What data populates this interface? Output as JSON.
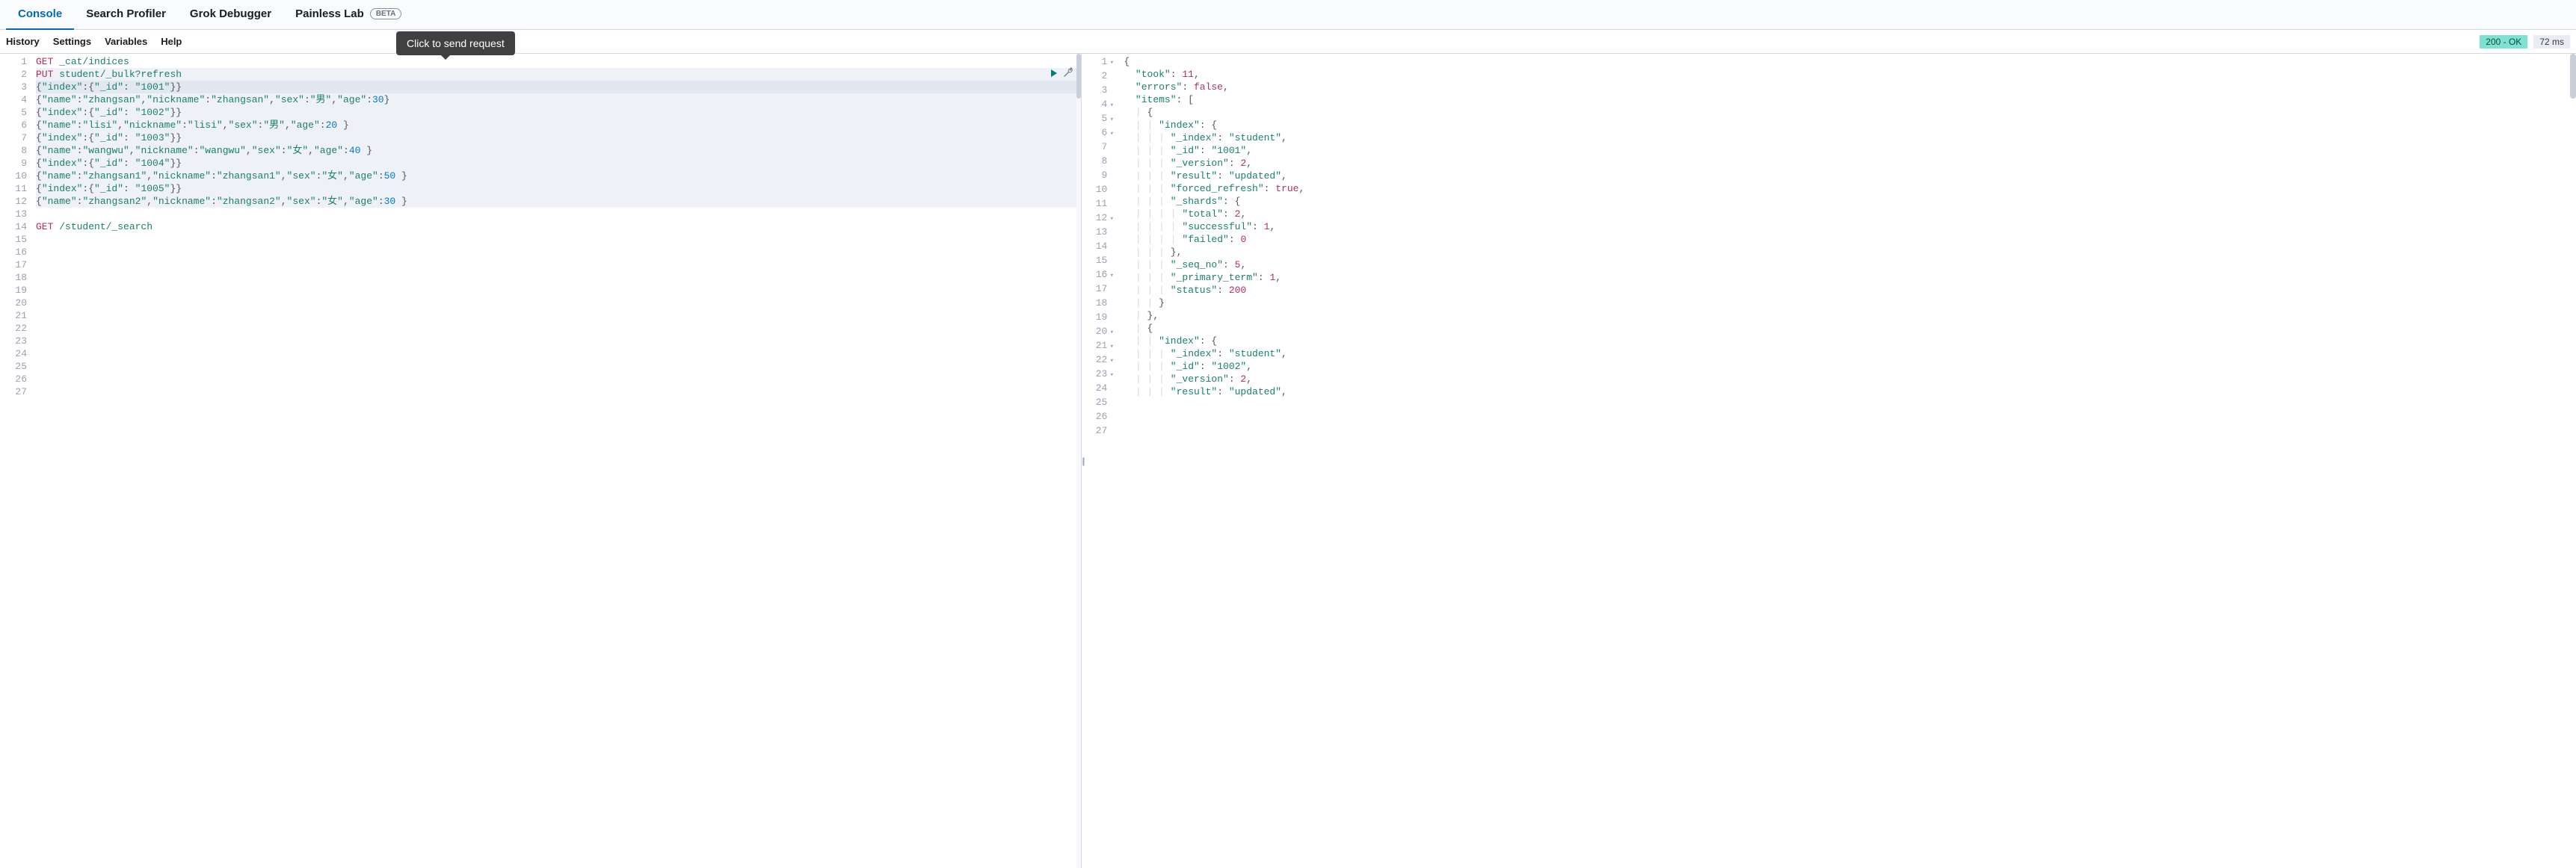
{
  "tabs": {
    "console": "Console",
    "search_profiler": "Search Profiler",
    "grok_debugger": "Grok Debugger",
    "painless_lab": "Painless Lab",
    "beta_badge": "BETA"
  },
  "toolbar": {
    "history": "History",
    "settings": "Settings",
    "variables": "Variables",
    "help": "Help"
  },
  "tooltip": "Click to send request",
  "status": {
    "ok": "200 - OK",
    "ms": "72 ms"
  },
  "request_editor": {
    "lines": [
      {
        "n": 1,
        "met": "GET",
        "path": "_cat/indices"
      },
      {
        "n": 2,
        "met": "PUT",
        "path": "student/_bulk?refresh",
        "sel": true
      },
      {
        "n": 3,
        "raw_parts": [
          [
            "{",
            0
          ],
          [
            "\"index\"",
            1
          ],
          [
            ":{",
            0
          ],
          [
            "\"_id\"",
            1
          ],
          [
            ": ",
            0
          ],
          [
            "\"1001\"",
            2
          ],
          [
            "}}",
            0
          ]
        ],
        "cur": true
      },
      {
        "n": 4,
        "raw_parts": [
          [
            "{",
            0
          ],
          [
            "\"name\"",
            1
          ],
          [
            ":",
            0
          ],
          [
            "\"zhangsan\"",
            2
          ],
          [
            ",",
            0
          ],
          [
            "\"nickname\"",
            1
          ],
          [
            ":",
            0
          ],
          [
            "\"zhangsan\"",
            2
          ],
          [
            ",",
            0
          ],
          [
            "\"sex\"",
            1
          ],
          [
            ":",
            0
          ],
          [
            "\"男\"",
            2
          ],
          [
            ",",
            0
          ],
          [
            "\"age\"",
            1
          ],
          [
            ":",
            0
          ],
          [
            "30",
            3
          ],
          [
            "}",
            0
          ]
        ],
        "sel": true
      },
      {
        "n": 5,
        "raw_parts": [
          [
            "{",
            0
          ],
          [
            "\"index\"",
            1
          ],
          [
            ":{",
            0
          ],
          [
            "\"_id\"",
            1
          ],
          [
            ": ",
            0
          ],
          [
            "\"1002\"",
            2
          ],
          [
            "}}",
            0
          ]
        ],
        "sel": true
      },
      {
        "n": 6,
        "raw_parts": [
          [
            "{",
            0
          ],
          [
            "\"name\"",
            1
          ],
          [
            ":",
            0
          ],
          [
            "\"lisi\"",
            2
          ],
          [
            ",",
            0
          ],
          [
            "\"nickname\"",
            1
          ],
          [
            ":",
            0
          ],
          [
            "\"lisi\"",
            2
          ],
          [
            ",",
            0
          ],
          [
            "\"sex\"",
            1
          ],
          [
            ":",
            0
          ],
          [
            "\"男\"",
            2
          ],
          [
            ",",
            0
          ],
          [
            "\"age\"",
            1
          ],
          [
            ":",
            0
          ],
          [
            "20",
            3
          ],
          [
            " }",
            0
          ]
        ],
        "sel": true
      },
      {
        "n": 7,
        "raw_parts": [
          [
            "{",
            0
          ],
          [
            "\"index\"",
            1
          ],
          [
            ":{",
            0
          ],
          [
            "\"_id\"",
            1
          ],
          [
            ": ",
            0
          ],
          [
            "\"1003\"",
            2
          ],
          [
            "}}",
            0
          ]
        ],
        "sel": true
      },
      {
        "n": 8,
        "raw_parts": [
          [
            "{",
            0
          ],
          [
            "\"name\"",
            1
          ],
          [
            ":",
            0
          ],
          [
            "\"wangwu\"",
            2
          ],
          [
            ",",
            0
          ],
          [
            "\"nickname\"",
            1
          ],
          [
            ":",
            0
          ],
          [
            "\"wangwu\"",
            2
          ],
          [
            ",",
            0
          ],
          [
            "\"sex\"",
            1
          ],
          [
            ":",
            0
          ],
          [
            "\"女\"",
            2
          ],
          [
            ",",
            0
          ],
          [
            "\"age\"",
            1
          ],
          [
            ":",
            0
          ],
          [
            "40",
            3
          ],
          [
            " }",
            0
          ]
        ],
        "sel": true
      },
      {
        "n": 9,
        "raw_parts": [
          [
            "{",
            0
          ],
          [
            "\"index\"",
            1
          ],
          [
            ":{",
            0
          ],
          [
            "\"_id\"",
            1
          ],
          [
            ": ",
            0
          ],
          [
            "\"1004\"",
            2
          ],
          [
            "}}",
            0
          ]
        ],
        "sel": true
      },
      {
        "n": 10,
        "raw_parts": [
          [
            "{",
            0
          ],
          [
            "\"name\"",
            1
          ],
          [
            ":",
            0
          ],
          [
            "\"zhangsan1\"",
            2
          ],
          [
            ",",
            0
          ],
          [
            "\"nickname\"",
            1
          ],
          [
            ":",
            0
          ],
          [
            "\"zhangsan1\"",
            2
          ],
          [
            ",",
            0
          ],
          [
            "\"sex\"",
            1
          ],
          [
            ":",
            0
          ],
          [
            "\"女\"",
            2
          ],
          [
            ",",
            0
          ],
          [
            "\"age\"",
            1
          ],
          [
            ":",
            0
          ],
          [
            "50",
            3
          ],
          [
            " }",
            0
          ]
        ],
        "sel": true
      },
      {
        "n": 11,
        "raw_parts": [
          [
            "{",
            0
          ],
          [
            "\"index\"",
            1
          ],
          [
            ":{",
            0
          ],
          [
            "\"_id\"",
            1
          ],
          [
            ": ",
            0
          ],
          [
            "\"1005\"",
            2
          ],
          [
            "}}",
            0
          ]
        ],
        "sel": true
      },
      {
        "n": 12,
        "raw_parts": [
          [
            "{",
            0
          ],
          [
            "\"name\"",
            1
          ],
          [
            ":",
            0
          ],
          [
            "\"zhangsan2\"",
            2
          ],
          [
            ",",
            0
          ],
          [
            "\"nickname\"",
            1
          ],
          [
            ":",
            0
          ],
          [
            "\"zhangsan2\"",
            2
          ],
          [
            ",",
            0
          ],
          [
            "\"sex\"",
            1
          ],
          [
            ":",
            0
          ],
          [
            "\"女\"",
            2
          ],
          [
            ",",
            0
          ],
          [
            "\"age\"",
            1
          ],
          [
            ":",
            0
          ],
          [
            "30",
            3
          ],
          [
            " }",
            0
          ]
        ],
        "sel": true
      },
      {
        "n": 13,
        "blank": true
      },
      {
        "n": 14,
        "met": "GET",
        "path": "/student/_search"
      },
      {
        "n": 15,
        "blank": true
      },
      {
        "n": 16,
        "blank": true
      },
      {
        "n": 17,
        "blank": true
      },
      {
        "n": 18,
        "blank": true
      },
      {
        "n": 19,
        "blank": true
      },
      {
        "n": 20,
        "blank": true
      },
      {
        "n": 21,
        "blank": true
      },
      {
        "n": 22,
        "blank": true
      },
      {
        "n": 23,
        "blank": true
      },
      {
        "n": 24,
        "blank": true
      },
      {
        "n": 25,
        "blank": true
      },
      {
        "n": 26,
        "blank": true
      },
      {
        "n": 27,
        "blank": true
      }
    ]
  },
  "response_editor": {
    "lines": [
      {
        "n": 1,
        "fold": "▾",
        "indent": 0,
        "pipes": 0,
        "parts": [
          [
            "{",
            0
          ]
        ]
      },
      {
        "n": 2,
        "indent": 1,
        "pipes": 0,
        "parts": [
          [
            "\"took\"",
            1
          ],
          [
            ": ",
            0
          ],
          [
            "11",
            4
          ],
          [
            ",",
            0
          ]
        ]
      },
      {
        "n": 3,
        "indent": 1,
        "pipes": 0,
        "parts": [
          [
            "\"errors\"",
            1
          ],
          [
            ": ",
            0
          ],
          [
            "false",
            5
          ],
          [
            ",",
            0
          ]
        ]
      },
      {
        "n": 4,
        "fold": "▾",
        "indent": 1,
        "pipes": 0,
        "parts": [
          [
            "\"items\"",
            1
          ],
          [
            ": [",
            0
          ]
        ]
      },
      {
        "n": 5,
        "fold": "▾",
        "indent": 2,
        "pipes": 1,
        "parts": [
          [
            "{",
            0
          ]
        ]
      },
      {
        "n": 6,
        "fold": "▾",
        "indent": 3,
        "pipes": 2,
        "parts": [
          [
            "\"index\"",
            1
          ],
          [
            ": {",
            0
          ]
        ]
      },
      {
        "n": 7,
        "indent": 4,
        "pipes": 3,
        "parts": [
          [
            "\"_index\"",
            1
          ],
          [
            ": ",
            0
          ],
          [
            "\"student\"",
            2
          ],
          [
            ",",
            0
          ]
        ]
      },
      {
        "n": 8,
        "indent": 4,
        "pipes": 3,
        "parts": [
          [
            "\"_id\"",
            1
          ],
          [
            ": ",
            0
          ],
          [
            "\"1001\"",
            2
          ],
          [
            ",",
            0
          ]
        ]
      },
      {
        "n": 9,
        "indent": 4,
        "pipes": 3,
        "parts": [
          [
            "\"_version\"",
            1
          ],
          [
            ": ",
            0
          ],
          [
            "2",
            4
          ],
          [
            ",",
            0
          ]
        ]
      },
      {
        "n": 10,
        "indent": 4,
        "pipes": 3,
        "parts": [
          [
            "\"result\"",
            1
          ],
          [
            ": ",
            0
          ],
          [
            "\"updated\"",
            2
          ],
          [
            ",",
            0
          ]
        ]
      },
      {
        "n": 11,
        "indent": 4,
        "pipes": 3,
        "parts": [
          [
            "\"forced_refresh\"",
            1
          ],
          [
            ": ",
            0
          ],
          [
            "true",
            5
          ],
          [
            ",",
            0
          ]
        ]
      },
      {
        "n": 12,
        "fold": "▾",
        "indent": 4,
        "pipes": 3,
        "parts": [
          [
            "\"_shards\"",
            1
          ],
          [
            ": {",
            0
          ]
        ]
      },
      {
        "n": 13,
        "indent": 5,
        "pipes": 4,
        "parts": [
          [
            "\"total\"",
            1
          ],
          [
            ": ",
            0
          ],
          [
            "2",
            4
          ],
          [
            ",",
            0
          ]
        ]
      },
      {
        "n": 14,
        "indent": 5,
        "pipes": 4,
        "parts": [
          [
            "\"successful\"",
            1
          ],
          [
            ": ",
            0
          ],
          [
            "1",
            4
          ],
          [
            ",",
            0
          ]
        ]
      },
      {
        "n": 15,
        "indent": 5,
        "pipes": 4,
        "parts": [
          [
            "\"failed\"",
            1
          ],
          [
            ": ",
            0
          ],
          [
            "0",
            4
          ]
        ]
      },
      {
        "n": 16,
        "fold": "▾",
        "indent": 4,
        "pipes": 3,
        "parts": [
          [
            "},",
            0
          ]
        ]
      },
      {
        "n": 17,
        "indent": 4,
        "pipes": 3,
        "parts": [
          [
            "\"_seq_no\"",
            1
          ],
          [
            ": ",
            0
          ],
          [
            "5",
            4
          ],
          [
            ",",
            0
          ]
        ]
      },
      {
        "n": 18,
        "indent": 4,
        "pipes": 3,
        "parts": [
          [
            "\"_primary_term\"",
            1
          ],
          [
            ": ",
            0
          ],
          [
            "1",
            4
          ],
          [
            ",",
            0
          ]
        ]
      },
      {
        "n": 19,
        "indent": 4,
        "pipes": 3,
        "parts": [
          [
            "\"status\"",
            1
          ],
          [
            ": ",
            0
          ],
          [
            "200",
            4
          ]
        ]
      },
      {
        "n": 20,
        "fold": "▾",
        "indent": 3,
        "pipes": 2,
        "parts": [
          [
            "}",
            0
          ]
        ]
      },
      {
        "n": 21,
        "fold": "▾",
        "indent": 2,
        "pipes": 1,
        "parts": [
          [
            "},",
            0
          ]
        ]
      },
      {
        "n": 22,
        "fold": "▾",
        "indent": 2,
        "pipes": 1,
        "parts": [
          [
            "{",
            0
          ]
        ]
      },
      {
        "n": 23,
        "fold": "▾",
        "indent": 3,
        "pipes": 2,
        "parts": [
          [
            "\"index\"",
            1
          ],
          [
            ": {",
            0
          ]
        ]
      },
      {
        "n": 24,
        "indent": 4,
        "pipes": 3,
        "parts": [
          [
            "\"_index\"",
            1
          ],
          [
            ": ",
            0
          ],
          [
            "\"student\"",
            2
          ],
          [
            ",",
            0
          ]
        ]
      },
      {
        "n": 25,
        "indent": 4,
        "pipes": 3,
        "parts": [
          [
            "\"_id\"",
            1
          ],
          [
            ": ",
            0
          ],
          [
            "\"1002\"",
            2
          ],
          [
            ",",
            0
          ]
        ]
      },
      {
        "n": 26,
        "indent": 4,
        "pipes": 3,
        "parts": [
          [
            "\"_version\"",
            1
          ],
          [
            ": ",
            0
          ],
          [
            "2",
            4
          ],
          [
            ",",
            0
          ]
        ]
      },
      {
        "n": 27,
        "indent": 4,
        "pipes": 3,
        "parts": [
          [
            "\"result\"",
            1
          ],
          [
            ": ",
            0
          ],
          [
            "\"updated\"",
            2
          ],
          [
            ",",
            0
          ]
        ]
      }
    ]
  }
}
